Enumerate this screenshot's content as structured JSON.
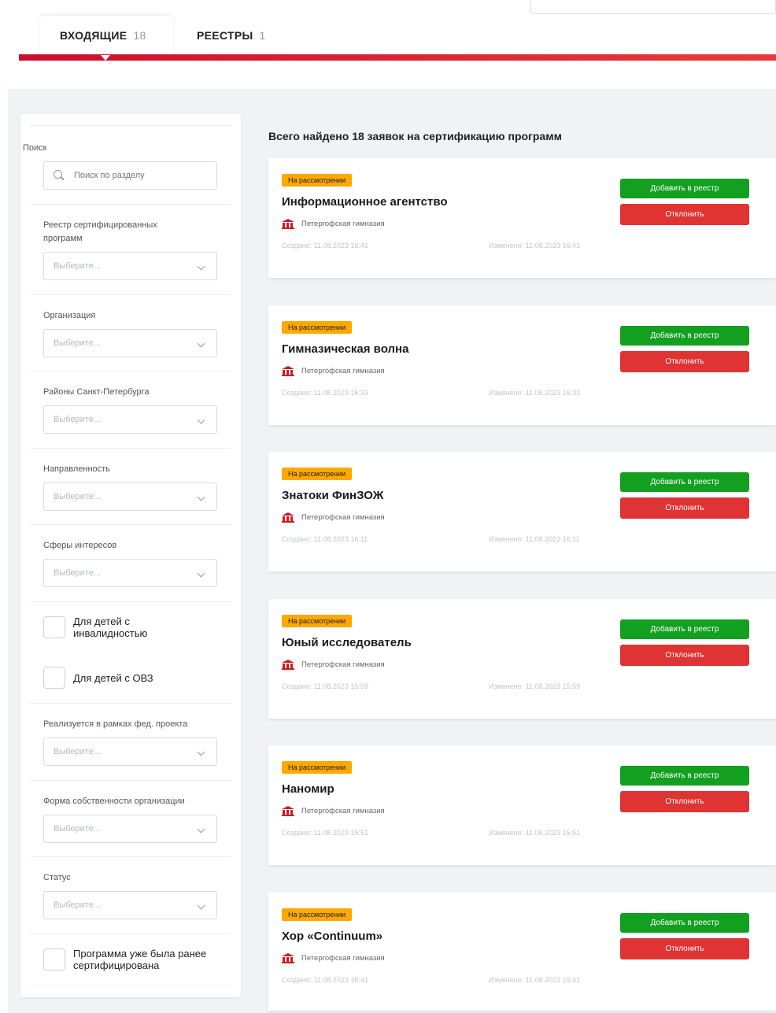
{
  "tabs": [
    {
      "label": "ВХОДЯЩИЕ",
      "count": "18"
    },
    {
      "label": "РЕЕСТРЫ",
      "count": "1"
    }
  ],
  "result_text": "Всего найдено 18 заявок на сертификацию программ",
  "filters": {
    "search_label": "Поиск",
    "search_placeholder": "Поиск по разделу",
    "select_placeholder": "Выберите...",
    "registry_label": "Реестр сертифицированных программ",
    "organization_label": "Организация",
    "districts_label": "Районы Санкт-Петербурга",
    "direction_label": "Направленность",
    "interests_label": "Сферы интересов",
    "disabled_children_label": "Для детей с инвалидностью",
    "ovz_label": "Для детей с ОВЗ",
    "fed_project_label": "Реализуется в рамках фед. проекта",
    "ownership_label": "Форма собственности организации",
    "status_label": "Статус",
    "certified_before_label": "Программа уже была ранее сертифицирована"
  },
  "card_labels": {
    "add_button": "Добавить в реестр",
    "reject_button": "Отклонить"
  },
  "cards": [
    {
      "status": "На рассмотрении",
      "title": "Информационное агентство",
      "org": "Петергофская гимназия",
      "created": "Создано: 11.08.2023 16:41",
      "changed": "Изменено: 11.08.2023 16:41"
    },
    {
      "status": "На рассмотрении",
      "title": "Гимназическая волна",
      "org": "Петергофская гимназия",
      "created": "Создано: 11.08.2023 16:33",
      "changed": "Изменено: 11.08.2023 16:33"
    },
    {
      "status": "На рассмотрении",
      "title": "Знатоки ФинЗОЖ",
      "org": "Петергофская гимназия",
      "created": "Создано: 11.08.2023 16:11",
      "changed": "Изменено: 11.08.2023 16:11"
    },
    {
      "status": "На рассмотрении",
      "title": "Юный исследователь",
      "org": "Петергофская гимназия",
      "created": "Создано: 11.08.2023 15:59",
      "changed": "Изменено: 11.08.2023 15:59"
    },
    {
      "status": "На рассмотрении",
      "title": "Наномир",
      "org": "Петергофская гимназия",
      "created": "Создано: 11.08.2023 15:51",
      "changed": "Изменено: 11.08.2023 15:51"
    },
    {
      "status": "На рассмотрении",
      "title": "Хор «Continuum»",
      "org": "Петергофская гимназия",
      "created": "Создано: 11.08.2023 15:41",
      "changed": "Изменено: 11.08.2023 15:41"
    }
  ]
}
